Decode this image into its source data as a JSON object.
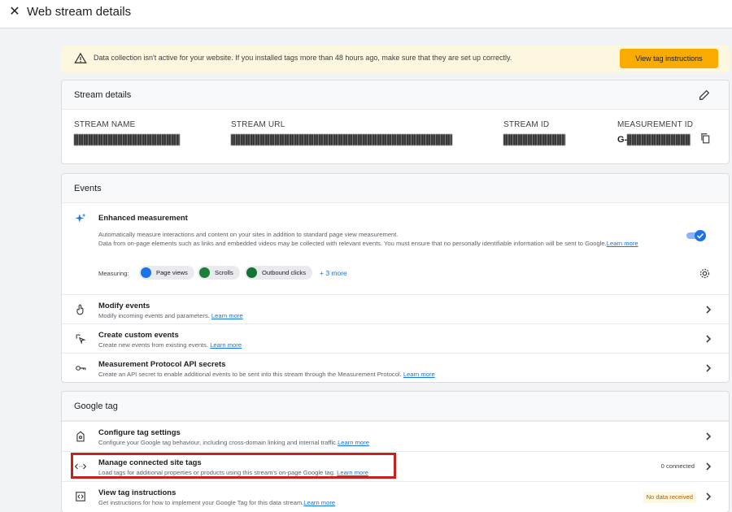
{
  "header": {
    "title": "Web stream details",
    "close_icon": "close-icon"
  },
  "banner": {
    "text": "Data collection isn't active for your website. If you installed tags more than 48 hours ago, make sure that they are set up correctly.",
    "button": "View tag instructions",
    "icon": "warning-icon"
  },
  "stream_details": {
    "title": "Stream details",
    "fields": [
      {
        "label": "STREAM NAME",
        "value": ""
      },
      {
        "label": "STREAM URL",
        "value": ""
      },
      {
        "label": "STREAM ID",
        "value": ""
      },
      {
        "label": "MEASUREMENT ID",
        "value": "G-"
      }
    ]
  },
  "events": {
    "title": "Events",
    "enhanced": {
      "title": "Enhanced measurement",
      "desc1": "Automatically measure interactions and content on your sites in addition to standard page view measurement.",
      "desc2": "Data from on-page elements such as links and embedded videos may be collected with relevant events. You must ensure that no personally identifiable information will be sent to Google.",
      "learn_more": "Learn more",
      "toggle_on": true,
      "measuring_label": "Measuring:",
      "chips": [
        "Page views",
        "Scrolls",
        "Outbound clicks"
      ],
      "more": "+ 3 more"
    },
    "rows": [
      {
        "title": "Modify events",
        "desc": "Modify incoming events and parameters.",
        "lm": "Learn more"
      },
      {
        "title": "Create custom events",
        "desc": "Create new events from existing events.",
        "lm": "Learn more"
      },
      {
        "title": "Measurement Protocol API secrets",
        "desc": "Create an API secret to enable additional events to be sent into this stream through the Measurement Protocol.",
        "lm": "Learn more"
      }
    ]
  },
  "google_tag": {
    "title": "Google tag",
    "rows": [
      {
        "title": "Configure tag settings",
        "desc": "Configure your Google tag behaviour, including cross-domain linking and internal traffic.",
        "lm": "Learn more"
      },
      {
        "title": "Manage connected site tags",
        "desc": "Load tags for additional properties or products using this stream's on-page Google tag.",
        "lm": "Learn more",
        "status": "0 connected"
      },
      {
        "title": "View tag instructions",
        "desc": "Get instructions for how to implement your Google Tag for this data stream.",
        "lm": "Learn more",
        "status": "No data received"
      }
    ]
  },
  "colors": {
    "accent": "#1a73e8",
    "warning_button": "#f9ab00",
    "highlight": "#c5221f"
  }
}
